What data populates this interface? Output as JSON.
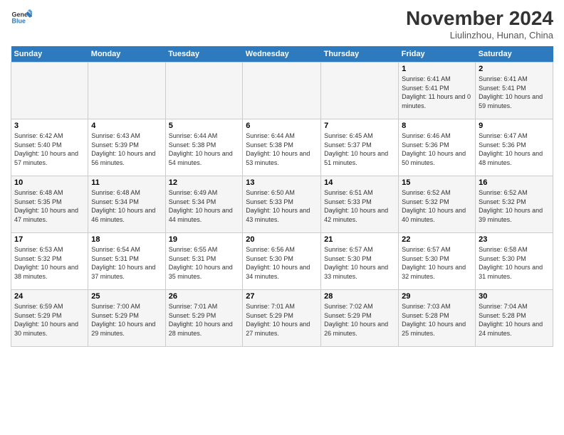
{
  "header": {
    "logo_line1": "General",
    "logo_line2": "Blue",
    "month": "November 2024",
    "location": "Liulinzhou, Hunan, China"
  },
  "weekdays": [
    "Sunday",
    "Monday",
    "Tuesday",
    "Wednesday",
    "Thursday",
    "Friday",
    "Saturday"
  ],
  "weeks": [
    [
      {
        "day": "",
        "sunrise": "",
        "sunset": "",
        "daylight": ""
      },
      {
        "day": "",
        "sunrise": "",
        "sunset": "",
        "daylight": ""
      },
      {
        "day": "",
        "sunrise": "",
        "sunset": "",
        "daylight": ""
      },
      {
        "day": "",
        "sunrise": "",
        "sunset": "",
        "daylight": ""
      },
      {
        "day": "",
        "sunrise": "",
        "sunset": "",
        "daylight": ""
      },
      {
        "day": "1",
        "sunrise": "Sunrise: 6:41 AM",
        "sunset": "Sunset: 5:41 PM",
        "daylight": "Daylight: 11 hours and 0 minutes."
      },
      {
        "day": "2",
        "sunrise": "Sunrise: 6:41 AM",
        "sunset": "Sunset: 5:41 PM",
        "daylight": "Daylight: 10 hours and 59 minutes."
      }
    ],
    [
      {
        "day": "3",
        "sunrise": "Sunrise: 6:42 AM",
        "sunset": "Sunset: 5:40 PM",
        "daylight": "Daylight: 10 hours and 57 minutes."
      },
      {
        "day": "4",
        "sunrise": "Sunrise: 6:43 AM",
        "sunset": "Sunset: 5:39 PM",
        "daylight": "Daylight: 10 hours and 56 minutes."
      },
      {
        "day": "5",
        "sunrise": "Sunrise: 6:44 AM",
        "sunset": "Sunset: 5:38 PM",
        "daylight": "Daylight: 10 hours and 54 minutes."
      },
      {
        "day": "6",
        "sunrise": "Sunrise: 6:44 AM",
        "sunset": "Sunset: 5:38 PM",
        "daylight": "Daylight: 10 hours and 53 minutes."
      },
      {
        "day": "7",
        "sunrise": "Sunrise: 6:45 AM",
        "sunset": "Sunset: 5:37 PM",
        "daylight": "Daylight: 10 hours and 51 minutes."
      },
      {
        "day": "8",
        "sunrise": "Sunrise: 6:46 AM",
        "sunset": "Sunset: 5:36 PM",
        "daylight": "Daylight: 10 hours and 50 minutes."
      },
      {
        "day": "9",
        "sunrise": "Sunrise: 6:47 AM",
        "sunset": "Sunset: 5:36 PM",
        "daylight": "Daylight: 10 hours and 48 minutes."
      }
    ],
    [
      {
        "day": "10",
        "sunrise": "Sunrise: 6:48 AM",
        "sunset": "Sunset: 5:35 PM",
        "daylight": "Daylight: 10 hours and 47 minutes."
      },
      {
        "day": "11",
        "sunrise": "Sunrise: 6:48 AM",
        "sunset": "Sunset: 5:34 PM",
        "daylight": "Daylight: 10 hours and 46 minutes."
      },
      {
        "day": "12",
        "sunrise": "Sunrise: 6:49 AM",
        "sunset": "Sunset: 5:34 PM",
        "daylight": "Daylight: 10 hours and 44 minutes."
      },
      {
        "day": "13",
        "sunrise": "Sunrise: 6:50 AM",
        "sunset": "Sunset: 5:33 PM",
        "daylight": "Daylight: 10 hours and 43 minutes."
      },
      {
        "day": "14",
        "sunrise": "Sunrise: 6:51 AM",
        "sunset": "Sunset: 5:33 PM",
        "daylight": "Daylight: 10 hours and 42 minutes."
      },
      {
        "day": "15",
        "sunrise": "Sunrise: 6:52 AM",
        "sunset": "Sunset: 5:32 PM",
        "daylight": "Daylight: 10 hours and 40 minutes."
      },
      {
        "day": "16",
        "sunrise": "Sunrise: 6:52 AM",
        "sunset": "Sunset: 5:32 PM",
        "daylight": "Daylight: 10 hours and 39 minutes."
      }
    ],
    [
      {
        "day": "17",
        "sunrise": "Sunrise: 6:53 AM",
        "sunset": "Sunset: 5:32 PM",
        "daylight": "Daylight: 10 hours and 38 minutes."
      },
      {
        "day": "18",
        "sunrise": "Sunrise: 6:54 AM",
        "sunset": "Sunset: 5:31 PM",
        "daylight": "Daylight: 10 hours and 37 minutes."
      },
      {
        "day": "19",
        "sunrise": "Sunrise: 6:55 AM",
        "sunset": "Sunset: 5:31 PM",
        "daylight": "Daylight: 10 hours and 35 minutes."
      },
      {
        "day": "20",
        "sunrise": "Sunrise: 6:56 AM",
        "sunset": "Sunset: 5:30 PM",
        "daylight": "Daylight: 10 hours and 34 minutes."
      },
      {
        "day": "21",
        "sunrise": "Sunrise: 6:57 AM",
        "sunset": "Sunset: 5:30 PM",
        "daylight": "Daylight: 10 hours and 33 minutes."
      },
      {
        "day": "22",
        "sunrise": "Sunrise: 6:57 AM",
        "sunset": "Sunset: 5:30 PM",
        "daylight": "Daylight: 10 hours and 32 minutes."
      },
      {
        "day": "23",
        "sunrise": "Sunrise: 6:58 AM",
        "sunset": "Sunset: 5:30 PM",
        "daylight": "Daylight: 10 hours and 31 minutes."
      }
    ],
    [
      {
        "day": "24",
        "sunrise": "Sunrise: 6:59 AM",
        "sunset": "Sunset: 5:29 PM",
        "daylight": "Daylight: 10 hours and 30 minutes."
      },
      {
        "day": "25",
        "sunrise": "Sunrise: 7:00 AM",
        "sunset": "Sunset: 5:29 PM",
        "daylight": "Daylight: 10 hours and 29 minutes."
      },
      {
        "day": "26",
        "sunrise": "Sunrise: 7:01 AM",
        "sunset": "Sunset: 5:29 PM",
        "daylight": "Daylight: 10 hours and 28 minutes."
      },
      {
        "day": "27",
        "sunrise": "Sunrise: 7:01 AM",
        "sunset": "Sunset: 5:29 PM",
        "daylight": "Daylight: 10 hours and 27 minutes."
      },
      {
        "day": "28",
        "sunrise": "Sunrise: 7:02 AM",
        "sunset": "Sunset: 5:29 PM",
        "daylight": "Daylight: 10 hours and 26 minutes."
      },
      {
        "day": "29",
        "sunrise": "Sunrise: 7:03 AM",
        "sunset": "Sunset: 5:28 PM",
        "daylight": "Daylight: 10 hours and 25 minutes."
      },
      {
        "day": "30",
        "sunrise": "Sunrise: 7:04 AM",
        "sunset": "Sunset: 5:28 PM",
        "daylight": "Daylight: 10 hours and 24 minutes."
      }
    ]
  ]
}
